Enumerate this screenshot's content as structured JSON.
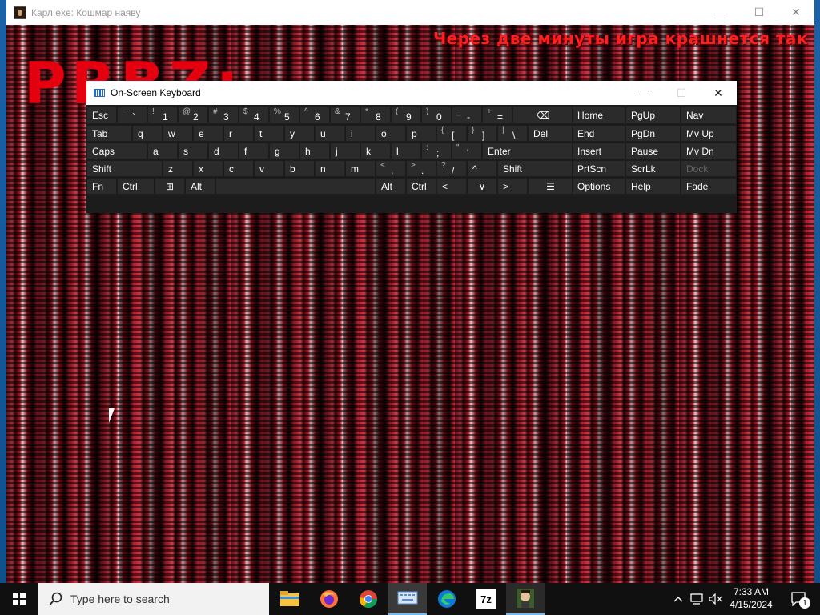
{
  "game_window": {
    "title": "Карл.exe: Кошмар наяву",
    "minimize_glyph": "—",
    "maximize_glyph": "☐",
    "close_glyph": "✕",
    "warning": "Через две минуты игра крашнется так",
    "big_glyphs": "PRBZ:"
  },
  "osk": {
    "title": "On-Screen Keyboard",
    "minimize_glyph": "—",
    "maximize_glyph": "☐",
    "close_glyph": "✕",
    "row1": [
      {
        "label": "Esc"
      },
      {
        "shift": "~",
        "main": "`"
      },
      {
        "shift": "!",
        "main": "1"
      },
      {
        "shift": "@",
        "main": "2"
      },
      {
        "shift": "#",
        "main": "3"
      },
      {
        "shift": "$",
        "main": "4"
      },
      {
        "shift": "%",
        "main": "5"
      },
      {
        "shift": "^",
        "main": "6"
      },
      {
        "shift": "&",
        "main": "7"
      },
      {
        "shift": "*",
        "main": "8"
      },
      {
        "shift": "(",
        "main": "9"
      },
      {
        "shift": ")",
        "main": "0"
      },
      {
        "shift": "_",
        "main": "-"
      },
      {
        "shift": "+",
        "main": "="
      },
      {
        "label": "⌫"
      }
    ],
    "row2": [
      {
        "label": "Tab"
      },
      {
        "label": "q"
      },
      {
        "label": "w"
      },
      {
        "label": "e"
      },
      {
        "label": "r"
      },
      {
        "label": "t"
      },
      {
        "label": "y"
      },
      {
        "label": "u"
      },
      {
        "label": "i"
      },
      {
        "label": "o"
      },
      {
        "label": "p"
      },
      {
        "shift": "{",
        "main": "["
      },
      {
        "shift": "}",
        "main": "]"
      },
      {
        "shift": "|",
        "main": "\\"
      },
      {
        "label": "Del"
      }
    ],
    "row3": [
      {
        "label": "Caps"
      },
      {
        "label": "a"
      },
      {
        "label": "s"
      },
      {
        "label": "d"
      },
      {
        "label": "f"
      },
      {
        "label": "g"
      },
      {
        "label": "h"
      },
      {
        "label": "j"
      },
      {
        "label": "k"
      },
      {
        "label": "l"
      },
      {
        "shift": ":",
        "main": ";"
      },
      {
        "shift": "\"",
        "main": "'"
      },
      {
        "label": "Enter"
      }
    ],
    "row4": [
      {
        "label": "Shift"
      },
      {
        "label": "z"
      },
      {
        "label": "x"
      },
      {
        "label": "c"
      },
      {
        "label": "v"
      },
      {
        "label": "b"
      },
      {
        "label": "n"
      },
      {
        "label": "m"
      },
      {
        "shift": "<",
        "main": ","
      },
      {
        "shift": ">",
        "main": "."
      },
      {
        "shift": "?",
        "main": "/"
      },
      {
        "label": "^"
      },
      {
        "label": "Shift"
      }
    ],
    "row5": [
      {
        "label": "Fn"
      },
      {
        "label": "Ctrl"
      },
      {
        "label": "⊞"
      },
      {
        "label": "Alt"
      },
      {
        "label": ""
      },
      {
        "label": "Alt"
      },
      {
        "label": "Ctrl"
      },
      {
        "label": "<"
      },
      {
        "label": "∨"
      },
      {
        "label": ">"
      },
      {
        "label": "☰"
      }
    ],
    "nav": [
      [
        "Home",
        "PgUp",
        "Nav"
      ],
      [
        "End",
        "PgDn",
        "Mv Up"
      ],
      [
        "Insert",
        "Pause",
        "Mv Dn"
      ],
      [
        "PrtScn",
        "ScrLk",
        "Dock"
      ],
      [
        "Options",
        "Help",
        "Fade"
      ]
    ]
  },
  "taskbar": {
    "search_placeholder": "Type here to search",
    "time": "7:33 AM",
    "date": "4/15/2024",
    "notification_count": "1",
    "apps": [
      "File Explorer",
      "Firefox",
      "Chrome",
      "On-Screen Keyboard",
      "Edge",
      "7-Zip",
      "Карл.exe"
    ],
    "sevenzip_label": "7z"
  }
}
